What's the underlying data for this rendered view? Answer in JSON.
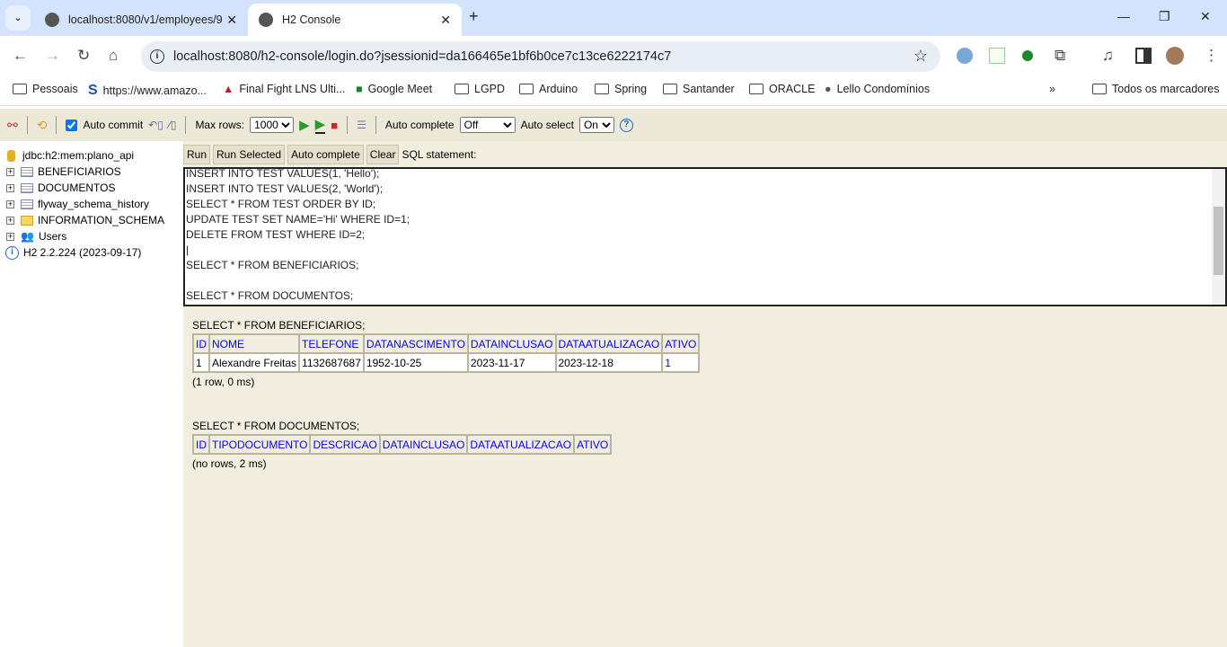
{
  "browser": {
    "tabs": [
      {
        "title": "localhost:8080/v1/employees/9"
      },
      {
        "title": "H2 Console",
        "active": true
      }
    ],
    "url": "localhost:8080/h2-console/login.do?jsessionid=da166465e1bf6b0ce7c13ce6222174c7",
    "bookmarks": [
      "Pessoais",
      "https://www.amazo...",
      "Final Fight LNS Ulti...",
      "Google Meet",
      "LGPD",
      "Arduino",
      "Spring",
      "Santander",
      "ORACLE",
      "Lello Condomínios"
    ],
    "all_bookmarks": "Todos os marcadores"
  },
  "toolbar": {
    "auto_commit": "Auto commit",
    "auto_commit_checked": true,
    "max_rows_label": "Max rows:",
    "max_rows": "1000",
    "auto_complete_label": "Auto complete",
    "auto_complete": "Off",
    "auto_select_label": "Auto select",
    "auto_select": "On",
    "help": "?"
  },
  "tree": {
    "connection": "jdbc:h2:mem:plano_api",
    "items": [
      "BENEFICIARIOS",
      "DOCUMENTOS",
      "flyway_schema_history",
      "INFORMATION_SCHEMA",
      "Users"
    ],
    "version": "H2 2.2.224 (2023-09-17)"
  },
  "editor": {
    "buttons": [
      "Run",
      "Run Selected",
      "Auto complete",
      "Clear"
    ],
    "label": "SQL statement:",
    "sql": "INSERT INTO TEST VALUES(1, 'Hello');\nINSERT INTO TEST VALUES(2, 'World');\nSELECT * FROM TEST ORDER BY ID;\nUPDATE TEST SET NAME='Hi' WHERE ID=1;\nDELETE FROM TEST WHERE ID=2;\n|\nSELECT * FROM BENEFICIARIOS;\n\nSELECT * FROM DOCUMENTOS;"
  },
  "results": [
    {
      "query": "SELECT * FROM BENEFICIARIOS;",
      "columns": [
        "ID",
        "NOME",
        "TELEFONE",
        "DATANASCIMENTO",
        "DATAINCLUSAO",
        "DATAATUALIZACAO",
        "ATIVO"
      ],
      "rows": [
        [
          "1",
          "Alexandre Freitas",
          "1132687687",
          "1952-10-25",
          "2023-11-17",
          "2023-12-18",
          "1"
        ]
      ],
      "status": "(1 row, 0 ms)"
    },
    {
      "query": "SELECT * FROM DOCUMENTOS;",
      "columns": [
        "ID",
        "TIPODOCUMENTO",
        "DESCRICAO",
        "DATAINCLUSAO",
        "DATAATUALIZACAO",
        "ATIVO"
      ],
      "rows": [],
      "status": "(no rows, 2 ms)"
    }
  ]
}
